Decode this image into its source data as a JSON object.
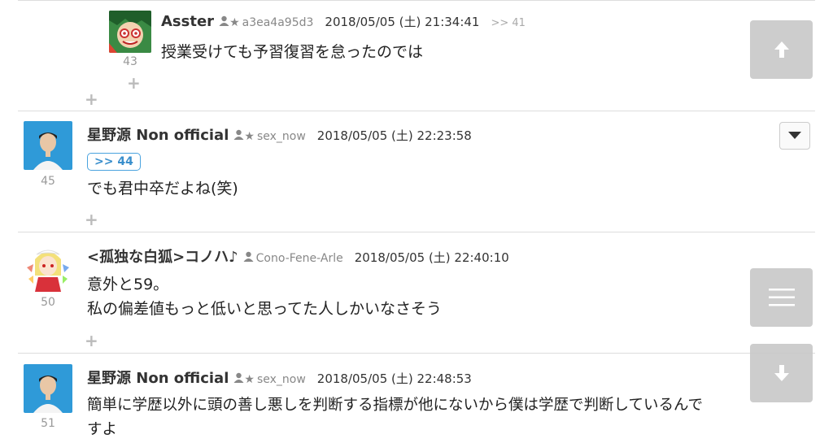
{
  "posts": [
    {
      "number": "43",
      "name": "Asster",
      "uid": "a3ea4a95d3",
      "time": "2018/05/05 (土) 21:34:41",
      "reply_link": ">> 41",
      "lines": [
        "授業受けても予習復習を怠ったのでは"
      ]
    },
    {
      "number": "45",
      "name": "星野源 Non official",
      "uid": "sex_now",
      "time": "2018/05/05 (土) 22:23:58",
      "anchor": ">> 44",
      "lines": [
        "でも君中卒だよね(笑)"
      ]
    },
    {
      "number": "50",
      "name": "<孤独な白狐>コノハ♪",
      "uid": "Cono-Fene-Arle",
      "time": "2018/05/05 (土) 22:40:10",
      "lines": [
        "意外と59。",
        "私の偏差値もっと低いと思ってた人しかいなさそう"
      ]
    },
    {
      "number": "51",
      "name": "星野源 Non official",
      "uid": "sex_now",
      "time": "2018/05/05 (土) 22:48:53",
      "lines": [
        "簡単に学歴以外に頭の善し悪しを判断する指標が他にないから僕は学歴で判断しているんで",
        "すよ"
      ]
    }
  ],
  "icons": {
    "user": "user-icon",
    "star": "star-icon",
    "plus": "plus-icon",
    "up": "arrow-up-icon",
    "down": "arrow-down-icon",
    "menu": "menu-icon",
    "caret": "caret-down-icon"
  },
  "colors": {
    "anchor_blue": "#4aa3df",
    "side_button": "#c9c9c9",
    "separator": "#dddddd"
  }
}
